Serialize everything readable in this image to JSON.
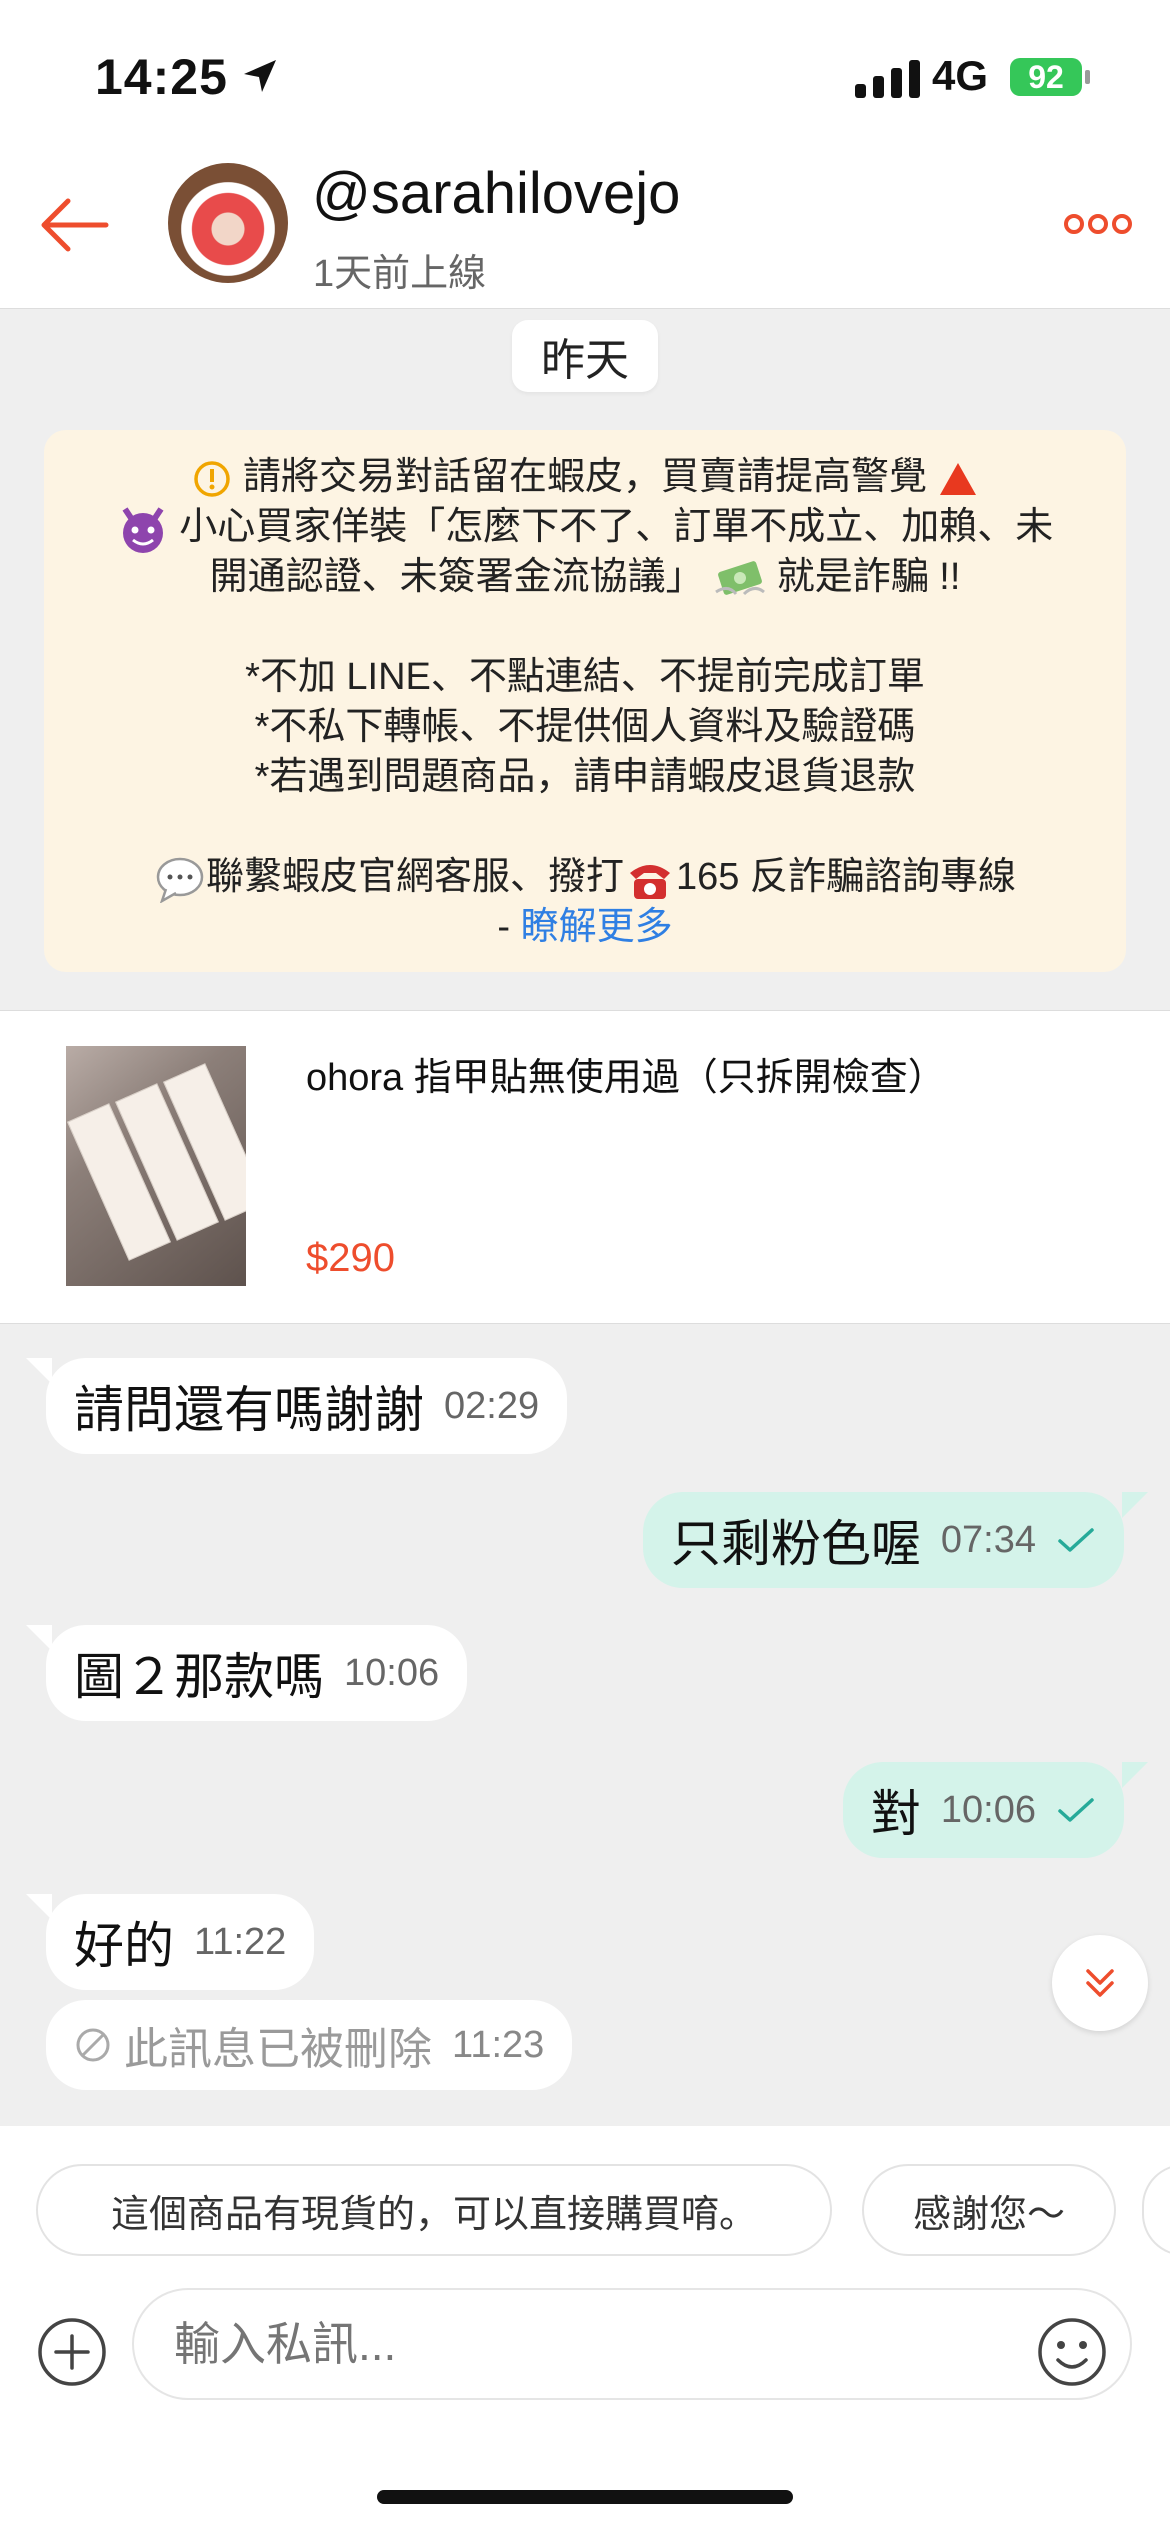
{
  "status_bar": {
    "time": "14:25",
    "network": "4G",
    "battery": "92"
  },
  "header": {
    "username": "@sarahilovejo",
    "last_seen": "1天前上線"
  },
  "date_separator": "昨天",
  "warning": {
    "line1": "請將交易對話留在蝦皮，買賣請提高警覺",
    "line2": "小心買家佯裝「怎麼下不了、訂單不成立、加賴、未",
    "line3": "開通認證、未簽署金流協議」",
    "line3_end": "就是詐騙 !!",
    "tips": [
      "*不加 LINE、不點連結、不提前完成訂單",
      "*不私下轉帳、不提供個人資料及驗證碼",
      "*若遇到問題商品，請申請蝦皮退貨退款"
    ],
    "contact_a": "聯繫蝦皮官網客服、撥打",
    "contact_b": "165 反詐騙諮詢專線",
    "link_prefix": "- ",
    "link": "瞭解更多"
  },
  "product": {
    "title": "ohora 指甲貼無使用過（只拆開檢查）",
    "price": "$290"
  },
  "messages": [
    {
      "dir": "in",
      "text": "請問還有嗎謝謝",
      "time": "02:29"
    },
    {
      "dir": "out",
      "text": "只剩粉色喔",
      "time": "07:34"
    },
    {
      "dir": "in",
      "text": "圖２那款嗎",
      "time": "10:06"
    },
    {
      "dir": "out",
      "text": "對",
      "time": "10:06"
    },
    {
      "dir": "in",
      "text": "好的",
      "time": "11:22"
    },
    {
      "dir": "in",
      "text": "此訊息已被刪除",
      "time": "11:23",
      "deleted": true
    }
  ],
  "quick_replies": [
    "這個商品有現貨的，可以直接購買唷。",
    "感謝您～"
  ],
  "composer": {
    "placeholder": "輸入私訊..."
  },
  "colors": {
    "accent": "#ee4d2d",
    "outgoing_bubble": "#d4f3ea",
    "tick": "#26aa99",
    "link": "#2f7fe3"
  }
}
